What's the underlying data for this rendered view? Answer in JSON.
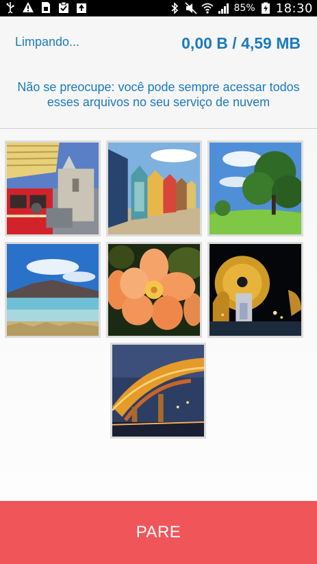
{
  "status_bar": {
    "battery": "85%",
    "time": "18:30",
    "icons": [
      "usb-icon",
      "warning-icon",
      "sim-icon",
      "clipboard-check-icon",
      "upload-icon",
      "bluetooth-icon",
      "mute-icon",
      "wifi-icon",
      "signal-icon",
      "battery-charging-icon"
    ]
  },
  "header": {
    "status": "Limpando...",
    "size": "0,00 B / 4,59 MB",
    "info": "Não se preocupe: você pode sempre acessar todos esses arquivos no seu serviço de nuvem"
  },
  "gallery": {
    "items": [
      {
        "name": "photo-red-bus-thumbnail"
      },
      {
        "name": "photo-beach-huts-thumbnail"
      },
      {
        "name": "photo-tree-field-thumbnail"
      },
      {
        "name": "photo-lake-mountain-thumbnail"
      },
      {
        "name": "photo-orange-flower-thumbnail"
      },
      {
        "name": "photo-night-monument-thumbnail"
      },
      {
        "name": "photo-bridge-night-thumbnail"
      }
    ]
  },
  "actions": {
    "stop_label": "PARE",
    "stop_color": "#f0555a"
  },
  "colors": {
    "accent": "#1a7abf",
    "background": "#f6f6f6"
  }
}
